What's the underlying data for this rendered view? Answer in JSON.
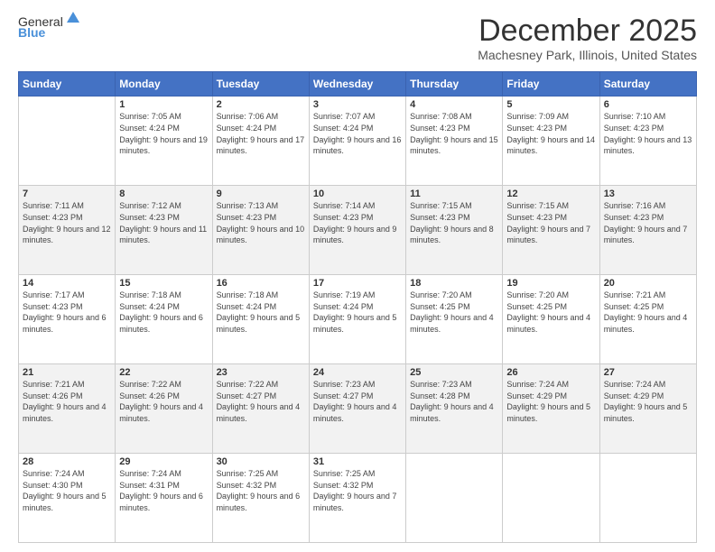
{
  "logo": {
    "general": "General",
    "blue": "Blue"
  },
  "header": {
    "month": "December 2025",
    "location": "Machesney Park, Illinois, United States"
  },
  "weekdays": [
    "Sunday",
    "Monday",
    "Tuesday",
    "Wednesday",
    "Thursday",
    "Friday",
    "Saturday"
  ],
  "weeks": [
    [
      {
        "day": "",
        "sunrise": "",
        "sunset": "",
        "daylight": ""
      },
      {
        "day": "1",
        "sunrise": "Sunrise: 7:05 AM",
        "sunset": "Sunset: 4:24 PM",
        "daylight": "Daylight: 9 hours and 19 minutes."
      },
      {
        "day": "2",
        "sunrise": "Sunrise: 7:06 AM",
        "sunset": "Sunset: 4:24 PM",
        "daylight": "Daylight: 9 hours and 17 minutes."
      },
      {
        "day": "3",
        "sunrise": "Sunrise: 7:07 AM",
        "sunset": "Sunset: 4:24 PM",
        "daylight": "Daylight: 9 hours and 16 minutes."
      },
      {
        "day": "4",
        "sunrise": "Sunrise: 7:08 AM",
        "sunset": "Sunset: 4:23 PM",
        "daylight": "Daylight: 9 hours and 15 minutes."
      },
      {
        "day": "5",
        "sunrise": "Sunrise: 7:09 AM",
        "sunset": "Sunset: 4:23 PM",
        "daylight": "Daylight: 9 hours and 14 minutes."
      },
      {
        "day": "6",
        "sunrise": "Sunrise: 7:10 AM",
        "sunset": "Sunset: 4:23 PM",
        "daylight": "Daylight: 9 hours and 13 minutes."
      }
    ],
    [
      {
        "day": "7",
        "sunrise": "Sunrise: 7:11 AM",
        "sunset": "Sunset: 4:23 PM",
        "daylight": "Daylight: 9 hours and 12 minutes."
      },
      {
        "day": "8",
        "sunrise": "Sunrise: 7:12 AM",
        "sunset": "Sunset: 4:23 PM",
        "daylight": "Daylight: 9 hours and 11 minutes."
      },
      {
        "day": "9",
        "sunrise": "Sunrise: 7:13 AM",
        "sunset": "Sunset: 4:23 PM",
        "daylight": "Daylight: 9 hours and 10 minutes."
      },
      {
        "day": "10",
        "sunrise": "Sunrise: 7:14 AM",
        "sunset": "Sunset: 4:23 PM",
        "daylight": "Daylight: 9 hours and 9 minutes."
      },
      {
        "day": "11",
        "sunrise": "Sunrise: 7:15 AM",
        "sunset": "Sunset: 4:23 PM",
        "daylight": "Daylight: 9 hours and 8 minutes."
      },
      {
        "day": "12",
        "sunrise": "Sunrise: 7:15 AM",
        "sunset": "Sunset: 4:23 PM",
        "daylight": "Daylight: 9 hours and 7 minutes."
      },
      {
        "day": "13",
        "sunrise": "Sunrise: 7:16 AM",
        "sunset": "Sunset: 4:23 PM",
        "daylight": "Daylight: 9 hours and 7 minutes."
      }
    ],
    [
      {
        "day": "14",
        "sunrise": "Sunrise: 7:17 AM",
        "sunset": "Sunset: 4:23 PM",
        "daylight": "Daylight: 9 hours and 6 minutes."
      },
      {
        "day": "15",
        "sunrise": "Sunrise: 7:18 AM",
        "sunset": "Sunset: 4:24 PM",
        "daylight": "Daylight: 9 hours and 6 minutes."
      },
      {
        "day": "16",
        "sunrise": "Sunrise: 7:18 AM",
        "sunset": "Sunset: 4:24 PM",
        "daylight": "Daylight: 9 hours and 5 minutes."
      },
      {
        "day": "17",
        "sunrise": "Sunrise: 7:19 AM",
        "sunset": "Sunset: 4:24 PM",
        "daylight": "Daylight: 9 hours and 5 minutes."
      },
      {
        "day": "18",
        "sunrise": "Sunrise: 7:20 AM",
        "sunset": "Sunset: 4:25 PM",
        "daylight": "Daylight: 9 hours and 4 minutes."
      },
      {
        "day": "19",
        "sunrise": "Sunrise: 7:20 AM",
        "sunset": "Sunset: 4:25 PM",
        "daylight": "Daylight: 9 hours and 4 minutes."
      },
      {
        "day": "20",
        "sunrise": "Sunrise: 7:21 AM",
        "sunset": "Sunset: 4:25 PM",
        "daylight": "Daylight: 9 hours and 4 minutes."
      }
    ],
    [
      {
        "day": "21",
        "sunrise": "Sunrise: 7:21 AM",
        "sunset": "Sunset: 4:26 PM",
        "daylight": "Daylight: 9 hours and 4 minutes."
      },
      {
        "day": "22",
        "sunrise": "Sunrise: 7:22 AM",
        "sunset": "Sunset: 4:26 PM",
        "daylight": "Daylight: 9 hours and 4 minutes."
      },
      {
        "day": "23",
        "sunrise": "Sunrise: 7:22 AM",
        "sunset": "Sunset: 4:27 PM",
        "daylight": "Daylight: 9 hours and 4 minutes."
      },
      {
        "day": "24",
        "sunrise": "Sunrise: 7:23 AM",
        "sunset": "Sunset: 4:27 PM",
        "daylight": "Daylight: 9 hours and 4 minutes."
      },
      {
        "day": "25",
        "sunrise": "Sunrise: 7:23 AM",
        "sunset": "Sunset: 4:28 PM",
        "daylight": "Daylight: 9 hours and 4 minutes."
      },
      {
        "day": "26",
        "sunrise": "Sunrise: 7:24 AM",
        "sunset": "Sunset: 4:29 PM",
        "daylight": "Daylight: 9 hours and 5 minutes."
      },
      {
        "day": "27",
        "sunrise": "Sunrise: 7:24 AM",
        "sunset": "Sunset: 4:29 PM",
        "daylight": "Daylight: 9 hours and 5 minutes."
      }
    ],
    [
      {
        "day": "28",
        "sunrise": "Sunrise: 7:24 AM",
        "sunset": "Sunset: 4:30 PM",
        "daylight": "Daylight: 9 hours and 5 minutes."
      },
      {
        "day": "29",
        "sunrise": "Sunrise: 7:24 AM",
        "sunset": "Sunset: 4:31 PM",
        "daylight": "Daylight: 9 hours and 6 minutes."
      },
      {
        "day": "30",
        "sunrise": "Sunrise: 7:25 AM",
        "sunset": "Sunset: 4:32 PM",
        "daylight": "Daylight: 9 hours and 6 minutes."
      },
      {
        "day": "31",
        "sunrise": "Sunrise: 7:25 AM",
        "sunset": "Sunset: 4:32 PM",
        "daylight": "Daylight: 9 hours and 7 minutes."
      },
      {
        "day": "",
        "sunrise": "",
        "sunset": "",
        "daylight": ""
      },
      {
        "day": "",
        "sunrise": "",
        "sunset": "",
        "daylight": ""
      },
      {
        "day": "",
        "sunrise": "",
        "sunset": "",
        "daylight": ""
      }
    ]
  ]
}
